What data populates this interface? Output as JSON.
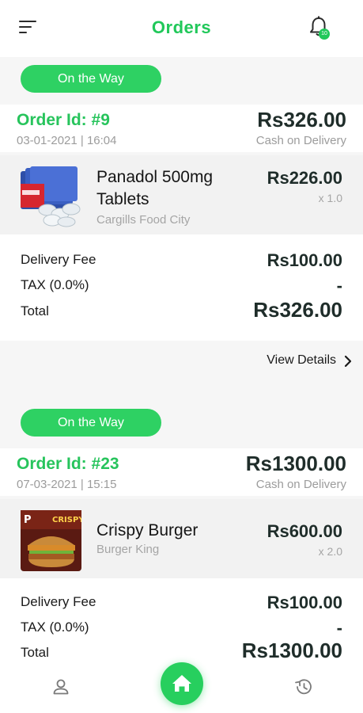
{
  "header": {
    "title": "Orders",
    "notification_badge": "10",
    "icons": {
      "menu": "menu-icon",
      "notifications": "bell-icon"
    }
  },
  "accent_color": "#21c85a",
  "orders": [
    {
      "status": "On the Way",
      "order_id": "Order Id: #9",
      "date": "03-01-2021 | 16:04",
      "amount": "Rs326.00",
      "payment": "Cash on Delivery",
      "item": {
        "name": "Panadol 500mg Tablets",
        "store": "Cargills Food City",
        "price": "Rs226.00",
        "qty": "x 1.0",
        "image": "panadol-product-image"
      },
      "summary": {
        "delivery_label": "Delivery Fee",
        "delivery_value": "Rs100.00",
        "tax_label": "TAX (0.0%)",
        "tax_value": "-",
        "total_label": "Total",
        "total_value": "Rs326.00"
      },
      "view_details": "View Details"
    },
    {
      "status": "On the Way",
      "order_id": "Order Id: #23",
      "date": "07-03-2021 | 15:15",
      "amount": "Rs1300.00",
      "payment": "Cash on Delivery",
      "item": {
        "name": "Crispy Burger",
        "store": "Burger King",
        "price": "Rs600.00",
        "qty": "x 2.0",
        "image": "crispy-burger-product-image",
        "image_text": "CRISPY"
      },
      "summary": {
        "delivery_label": "Delivery Fee",
        "delivery_value": "Rs100.00",
        "tax_label": "TAX (0.0%)",
        "tax_value": "-",
        "total_label": "Total",
        "total_value": "Rs1300.00"
      }
    }
  ],
  "bottom_nav": {
    "profile": "user-icon",
    "home": "home-icon",
    "history": "history-icon"
  }
}
